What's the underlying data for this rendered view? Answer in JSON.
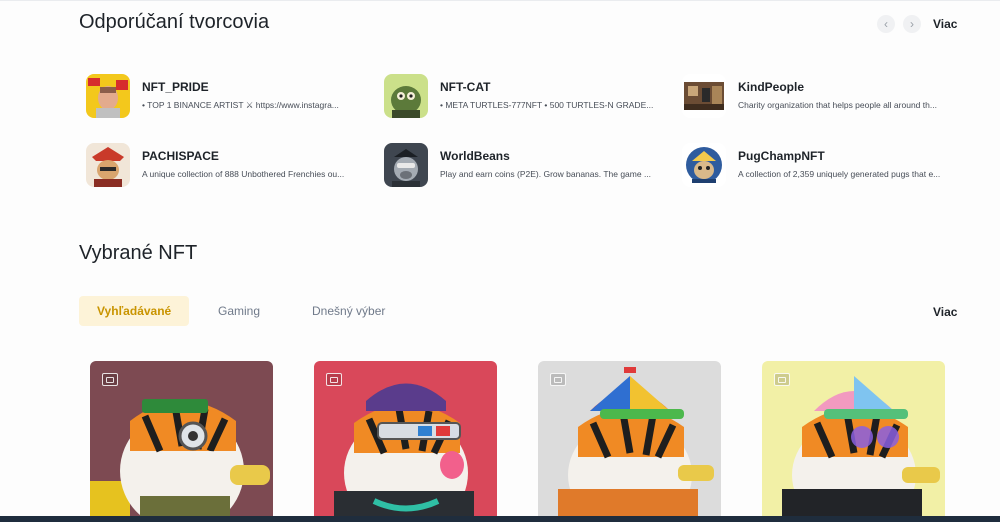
{
  "creators_section": {
    "title": "Odporúčaní tvorcovia",
    "more_label": "Viac",
    "prev_icon": "chevron-left-icon",
    "next_icon": "chevron-right-icon",
    "creators": [
      {
        "name": "NFT_PRIDE",
        "description": "• TOP 1 BINANCE ARTIST ⚔ https://www.instagra..."
      },
      {
        "name": "NFT-CAT",
        "description": "• META TURTLES-777NFT • 500 TURTLES-N GRADE..."
      },
      {
        "name": "KindPeople",
        "description": "Charity organization that helps people all around th..."
      },
      {
        "name": "PACHISPACE",
        "description": "A unique collection of 888 Unbothered Frenchies ou..."
      },
      {
        "name": "WorldBeans",
        "description": "Play and earn coins (P2E). Grow bananas. The game ..."
      },
      {
        "name": "PugChampNFT",
        "description": "A collection of 2,359 uniquely generated pugs that e..."
      }
    ]
  },
  "nft_section": {
    "title": "Vybrané NFT",
    "more_label": "Viac",
    "tabs": [
      {
        "label": "Vyhľadávané",
        "active": true
      },
      {
        "label": "Gaming",
        "active": false
      },
      {
        "label": "Dnešný výber",
        "active": false
      }
    ],
    "cards": [
      {
        "name": "tiger-nft-1",
        "background": "#7d4a52",
        "icon": "image-icon"
      },
      {
        "name": "tiger-nft-2",
        "background": "#d9485a",
        "icon": "image-icon"
      },
      {
        "name": "tiger-nft-3",
        "background": "#dcdcdc",
        "icon": "image-icon"
      },
      {
        "name": "tiger-nft-4",
        "background": "#f2f0a6",
        "icon": "image-icon"
      }
    ]
  },
  "colors": {
    "accent": "#c99400",
    "accent_bg": "#fdf3d8",
    "text": "#1e2329",
    "muted": "#707a8a"
  }
}
